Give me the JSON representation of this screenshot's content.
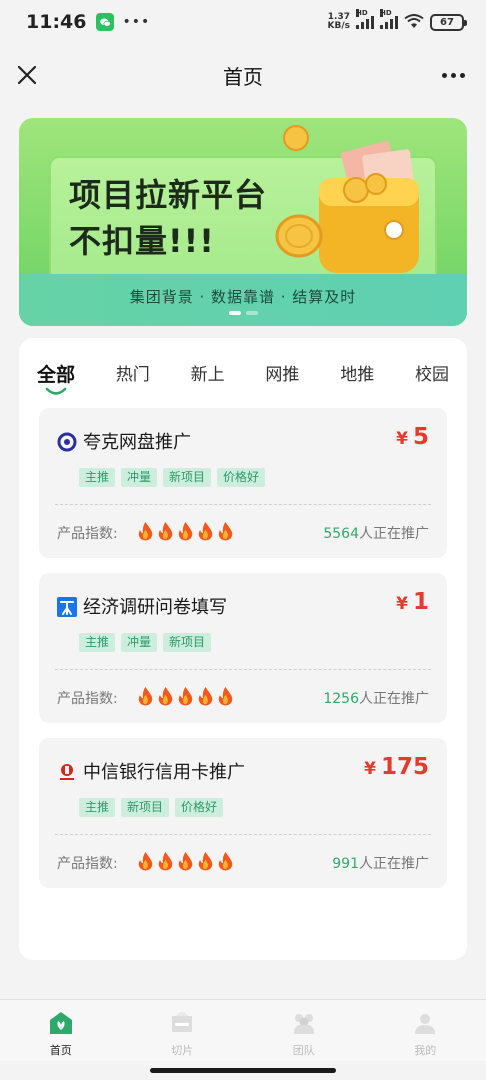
{
  "status": {
    "time": "11:46",
    "net_speed_value": "1.37",
    "net_speed_unit": "KB/s",
    "signal_1_label": "HD",
    "signal_2_label": "HD",
    "battery": "67"
  },
  "nav": {
    "title": "首页"
  },
  "banner": {
    "headline_line1": "项目拉新平台",
    "headline_line2": "不扣量!!!",
    "tagline": "集团背景 · 数据靠谱 · 结算及时",
    "active_slide": 1,
    "slide_count": 2
  },
  "tabs": [
    {
      "label": "全部",
      "active": true
    },
    {
      "label": "热门",
      "active": false
    },
    {
      "label": "新上",
      "active": false
    },
    {
      "label": "网推",
      "active": false
    },
    {
      "label": "地推",
      "active": false
    },
    {
      "label": "校园",
      "active": false
    }
  ],
  "cards": [
    {
      "icon": "quark-logo-icon",
      "title": "夸克网盘推广",
      "currency": "¥",
      "price": "5",
      "tags": [
        "主推",
        "冲量",
        "新项目",
        "价格好"
      ],
      "index_label": "产品指数:",
      "flame_count": 5,
      "promoters": "5564",
      "promoters_suffix": "人正在推广"
    },
    {
      "icon": "survey-app-icon",
      "title": "经济调研问卷填写",
      "currency": "¥",
      "price": "1",
      "tags": [
        "主推",
        "冲量",
        "新项目"
      ],
      "index_label": "产品指数:",
      "flame_count": 5,
      "promoters": "1256",
      "promoters_suffix": "人正在推广"
    },
    {
      "icon": "citic-bank-logo-icon",
      "title": "中信银行信用卡推广",
      "currency": "¥",
      "price": "175",
      "tags": [
        "主推",
        "新项目",
        "价格好"
      ],
      "index_label": "产品指数:",
      "flame_count": 5,
      "promoters": "991",
      "promoters_suffix": "人正在推广"
    }
  ],
  "tabbar": [
    {
      "label": "首页",
      "icon": "home-icon",
      "active": true
    },
    {
      "label": "切片",
      "icon": "slice-icon",
      "active": false
    },
    {
      "label": "团队",
      "icon": "team-icon",
      "active": false
    },
    {
      "label": "我的",
      "icon": "profile-icon",
      "active": false
    }
  ],
  "colors": {
    "accent_green": "#2daa6a",
    "price_red": "#e53a2c",
    "tag_bg": "#cdeedd",
    "tag_text": "#2d9a66"
  }
}
